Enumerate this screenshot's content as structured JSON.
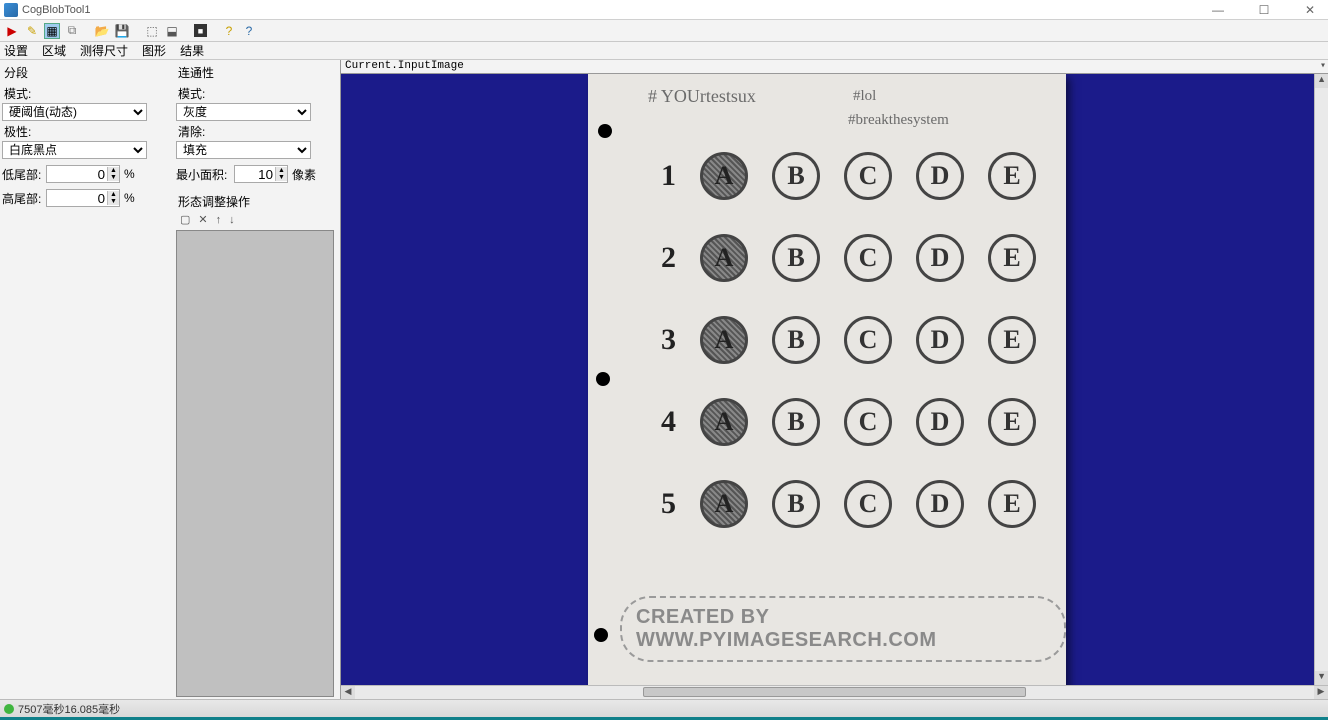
{
  "window": {
    "title": "CogBlobTool1"
  },
  "menu": {
    "m1": "设置",
    "m2": "区域",
    "m3": "测得尺寸",
    "m4": "图形",
    "m5": "结果"
  },
  "panel": {
    "seg_header": "分段",
    "mode_label": "模式:",
    "mode_value": "硬阈值(动态)",
    "polarity_label": "极性:",
    "polarity_value": "白底黑点",
    "lowtail_label": "低尾部:",
    "lowtail_value": "0",
    "lowtail_unit": "%",
    "hightail_label": "高尾部:",
    "hightail_value": "0",
    "hightail_unit": "%",
    "conn_header": "连通性",
    "conn_mode_label": "模式:",
    "conn_mode_value": "灰度",
    "clean_label": "清除:",
    "clean_value": "填充",
    "minarea_label": "最小面积:",
    "minarea_value": "10",
    "minarea_unit": "像素",
    "morph_label": "形态调整操作"
  },
  "image": {
    "caption": "Current.InputImage",
    "hash1": "# YOUrtestsux",
    "hash2": "#lol",
    "hash3": "#breakthesystem",
    "watermark": "CREATED BY WWW.PYIMAGESEARCH.COM",
    "questions": [
      {
        "n": "1",
        "opts": [
          "A",
          "B",
          "C",
          "D",
          "E"
        ],
        "filled": 0
      },
      {
        "n": "2",
        "opts": [
          "A",
          "B",
          "C",
          "D",
          "E"
        ],
        "filled": 0
      },
      {
        "n": "3",
        "opts": [
          "A",
          "B",
          "C",
          "D",
          "E"
        ],
        "filled": 0
      },
      {
        "n": "4",
        "opts": [
          "A",
          "B",
          "C",
          "D",
          "E"
        ],
        "filled": 0
      },
      {
        "n": "5",
        "opts": [
          "A",
          "B",
          "C",
          "D",
          "E"
        ],
        "filled": 0
      }
    ]
  },
  "status": {
    "text": "7507毫秒16.085毫秒"
  }
}
